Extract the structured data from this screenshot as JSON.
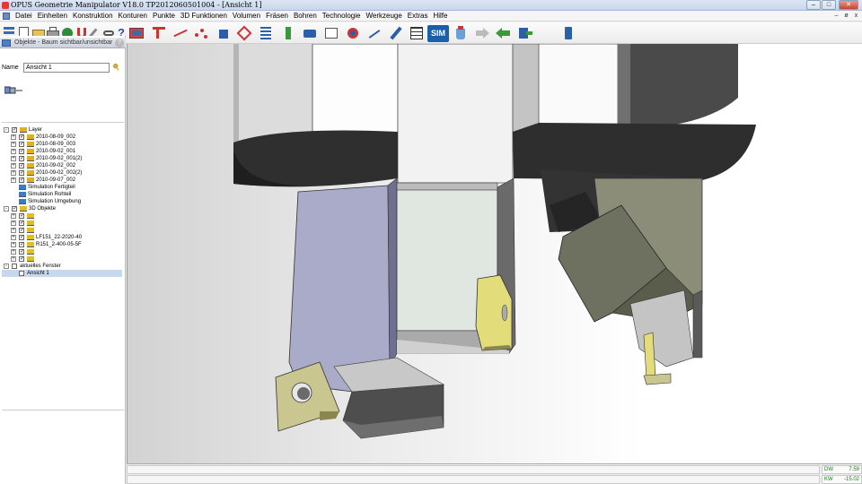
{
  "window": {
    "title": "OPUS Geometrie Manipulator V18.0   TP2012060501004   - [Ansicht 1]",
    "controls": {
      "minimize": "–",
      "maximize": "□",
      "close": "✕"
    }
  },
  "menu": {
    "items": [
      "Datei",
      "Einheiten",
      "Konstruktion",
      "Konturen",
      "Punkte",
      "3D Funktionen",
      "Volumen",
      "Fräsen",
      "Bohren",
      "Technologie",
      "Werkzeuge",
      "Extras",
      "Hilfe"
    ],
    "mdi_controls": {
      "minimize": "–",
      "restore": "ø",
      "close": "x"
    }
  },
  "toolbar": {
    "sim_label": "SIM",
    "icons": [
      "new-file-icon",
      "open-file-icon",
      "save-icon",
      "print-icon",
      "layers-icon",
      "magnet-icon",
      "help-icon",
      "machine-icon",
      "contour-icon",
      "points-icon",
      "3d-icon",
      "volume-icon",
      "mill-icon",
      "drill-icon",
      "tool-icon",
      "tech-icon",
      "transform-icon",
      "sim-icon",
      "paint-icon",
      "arrow-right-icon",
      "arrow-back-icon",
      "export-icon",
      "exit-icon"
    ]
  },
  "object_panel": {
    "header": "Objekte - Baum sichtbar/unsichtbar",
    "help_icon": "?",
    "name_label": "Name",
    "name_value": "Ansicht 1",
    "tree": [
      {
        "level": 0,
        "expander": "-",
        "checked": true,
        "icon": "layer",
        "label": "Layer"
      },
      {
        "level": 1,
        "expander": "+",
        "checked": true,
        "icon": "layer",
        "label": "2010-08-09_002"
      },
      {
        "level": 1,
        "expander": "+",
        "checked": true,
        "icon": "layer",
        "label": "2010-08-09_003"
      },
      {
        "level": 1,
        "expander": "+",
        "checked": true,
        "icon": "layer",
        "label": "2010-09-02_001"
      },
      {
        "level": 1,
        "expander": "+",
        "checked": true,
        "icon": "layer",
        "label": "2010-09-02_001(2)"
      },
      {
        "level": 1,
        "expander": "+",
        "checked": true,
        "icon": "layer",
        "label": "2010-09-02_002"
      },
      {
        "level": 1,
        "expander": "+",
        "checked": true,
        "icon": "layer",
        "label": "2010-09-02_002(2)"
      },
      {
        "level": 1,
        "expander": "+",
        "checked": true,
        "icon": "layer",
        "label": "2010-09-07_002"
      },
      {
        "level": 1,
        "expander": "",
        "checked": null,
        "icon": "sim",
        "label": "Simulation Fertigteil"
      },
      {
        "level": 1,
        "expander": "",
        "checked": null,
        "icon": "sim",
        "label": "Simulation Rohteil"
      },
      {
        "level": 1,
        "expander": "",
        "checked": null,
        "icon": "sim",
        "label": "Simulation Umgebung"
      },
      {
        "level": 0,
        "expander": "-",
        "checked": true,
        "icon": "obj3d",
        "label": "3D Objekte"
      },
      {
        "level": 1,
        "expander": "+",
        "checked": true,
        "icon": "obj3d",
        "label": ""
      },
      {
        "level": 1,
        "expander": "+",
        "checked": true,
        "icon": "obj3d",
        "label": ""
      },
      {
        "level": 1,
        "expander": "+",
        "checked": true,
        "icon": "obj3d",
        "label": ""
      },
      {
        "level": 1,
        "expander": "+",
        "checked": true,
        "icon": "obj3d",
        "label": "LF151_22-2020-40"
      },
      {
        "level": 1,
        "expander": "+",
        "checked": true,
        "icon": "obj3d",
        "label": "R151_2-400-05-5F"
      },
      {
        "level": 1,
        "expander": "+",
        "checked": true,
        "icon": "obj3d",
        "label": ""
      },
      {
        "level": 1,
        "expander": "+",
        "checked": true,
        "icon": "obj3d",
        "label": ""
      },
      {
        "level": 0,
        "expander": "-",
        "checked": false,
        "icon": "none",
        "label": "aktuelles Fenster"
      },
      {
        "level": 1,
        "expander": "",
        "checked": false,
        "icon": "none",
        "label": "Ansicht 1",
        "selected": true
      }
    ]
  },
  "status": {
    "dw_label": "DW",
    "dw_value": "7.59",
    "kw_label": "KW",
    "kw_value": "-15.02"
  },
  "colors": {
    "tool_body": "#d8d8d8",
    "tool_shadow": "#5a5a5a",
    "holder_dark": "#2e2e2e",
    "tool_blue": "#a9abc8",
    "insert": "#c9c690",
    "insert_bright": "#e2dc7a",
    "sim_blue": "#1a5faa",
    "coord_text": "#1a7a1a"
  }
}
